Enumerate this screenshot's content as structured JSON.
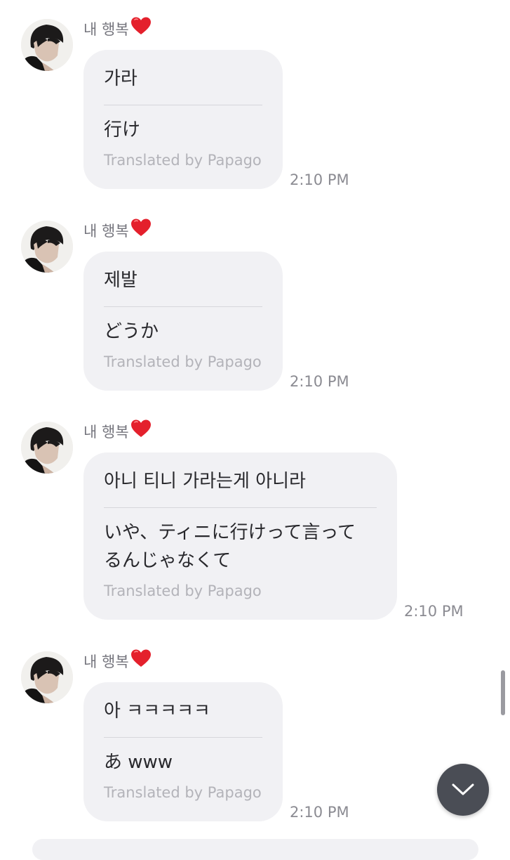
{
  "sender_name": "내 행복",
  "translation_credit": "Translated by Papago",
  "messages": [
    {
      "original": "가라",
      "translated": "行け",
      "time": "2:10 PM"
    },
    {
      "original": "제발",
      "translated": "どうか",
      "time": "2:10 PM"
    },
    {
      "original": "아니 티니 가라는게 아니라",
      "translated_line1": "いや、ティニに行けって言って",
      "translated_line2": "るんじゃなくて",
      "time": "2:10 PM"
    },
    {
      "original": "아 ㅋㅋㅋㅋㅋ",
      "translated": "あ www",
      "time": "2:10 PM"
    }
  ],
  "icons": {
    "heart": "red-heart-emoji",
    "scroll_down": "chevron-down-icon"
  },
  "colors": {
    "bubble": "#f1f1f4",
    "credit_text": "#b3b3b9",
    "timestamp": "#8b8b92",
    "scroll_button": "#4a4d55"
  }
}
